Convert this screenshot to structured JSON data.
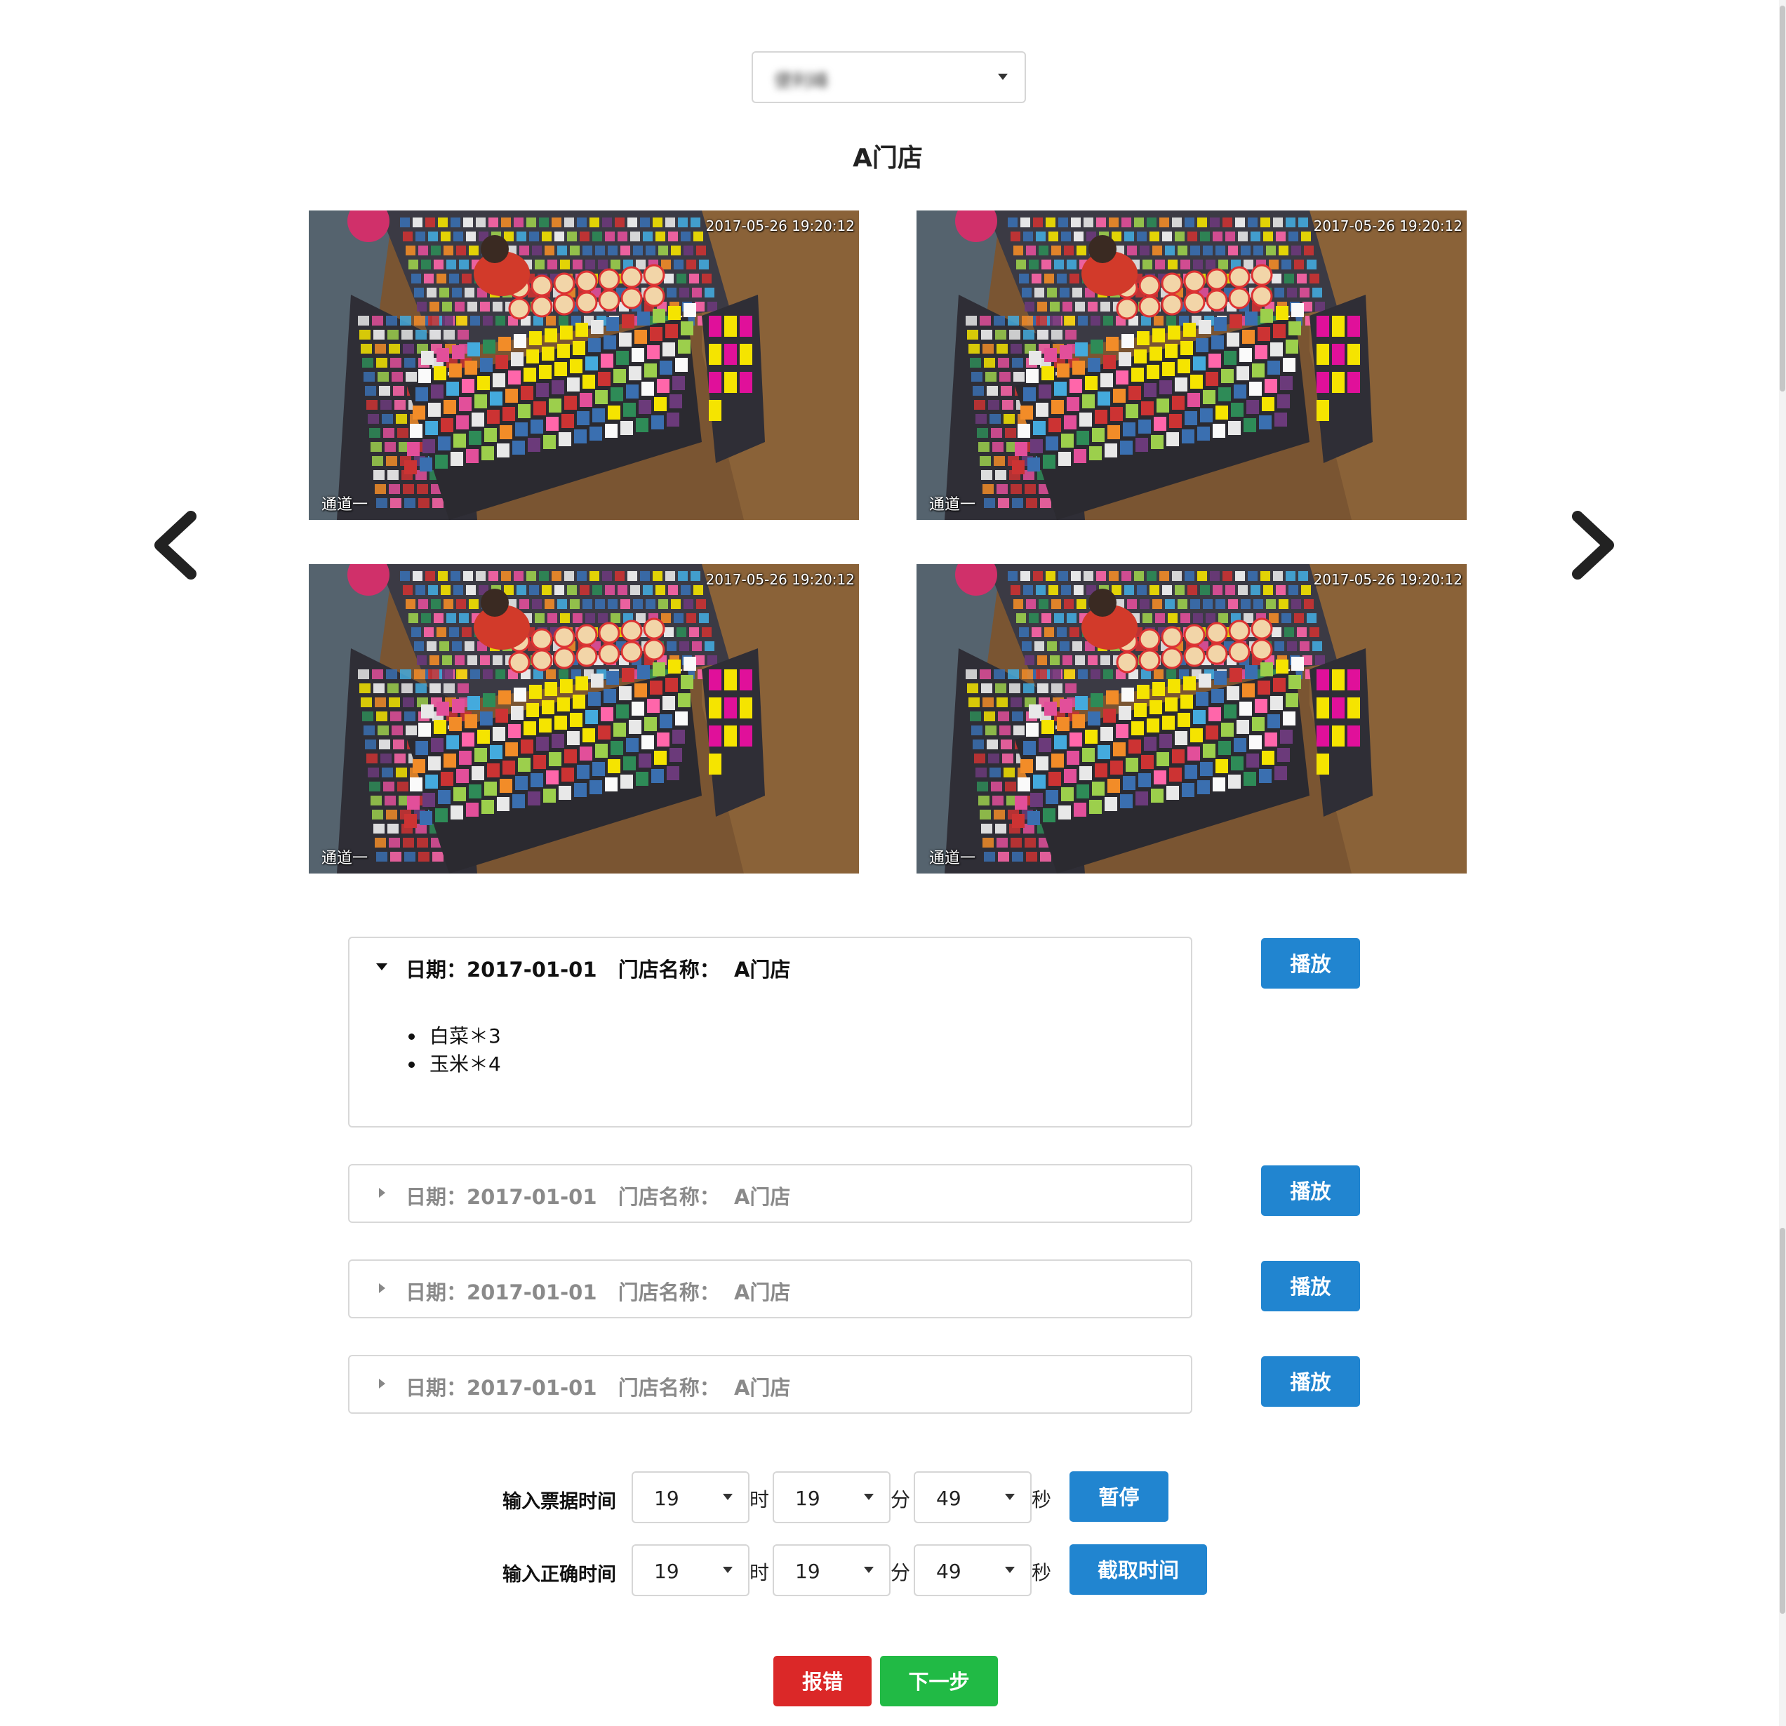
{
  "store_select": {
    "value": "便利峰"
  },
  "store_title": "A门店",
  "cameras": [
    {
      "timestamp": "2017-05-26 19:20:12",
      "channel": "通道一"
    },
    {
      "timestamp": "2017-05-26 19:20:12",
      "channel": "通道一"
    },
    {
      "timestamp": "2017-05-26 19:20:12",
      "channel": "通道一"
    },
    {
      "timestamp": "2017-05-26 19:20:12",
      "channel": "通道一"
    }
  ],
  "orders": [
    {
      "header": "日期：2017-01-01   门店名称：  A门店",
      "expanded": true,
      "items": [
        "白菜＊3",
        "玉米＊4"
      ],
      "play_label": "播放"
    },
    {
      "header": "日期：2017-01-01   门店名称：  A门店",
      "expanded": false,
      "play_label": "播放"
    },
    {
      "header": "日期：2017-01-01   门店名称：  A门店",
      "expanded": false,
      "play_label": "播放"
    },
    {
      "header": "日期：2017-01-01   门店名称：  A门店",
      "expanded": false,
      "play_label": "播放"
    }
  ],
  "receipt_time": {
    "label": "输入票据时间",
    "hour": "19",
    "minute": "19",
    "second": "49",
    "hour_unit": "时",
    "minute_unit": "分",
    "second_unit": "秒",
    "button_label": "暂停"
  },
  "correct_time": {
    "label": "输入正确时间",
    "hour": "19",
    "minute": "19",
    "second": "49",
    "hour_unit": "时",
    "minute_unit": "分",
    "second_unit": "秒",
    "button_label": "截取时间"
  },
  "actions": {
    "report_error": "报错",
    "next_step": "下一步"
  },
  "colors": {
    "primary": "#2185d0",
    "danger": "#db2828",
    "success": "#21ba45"
  }
}
